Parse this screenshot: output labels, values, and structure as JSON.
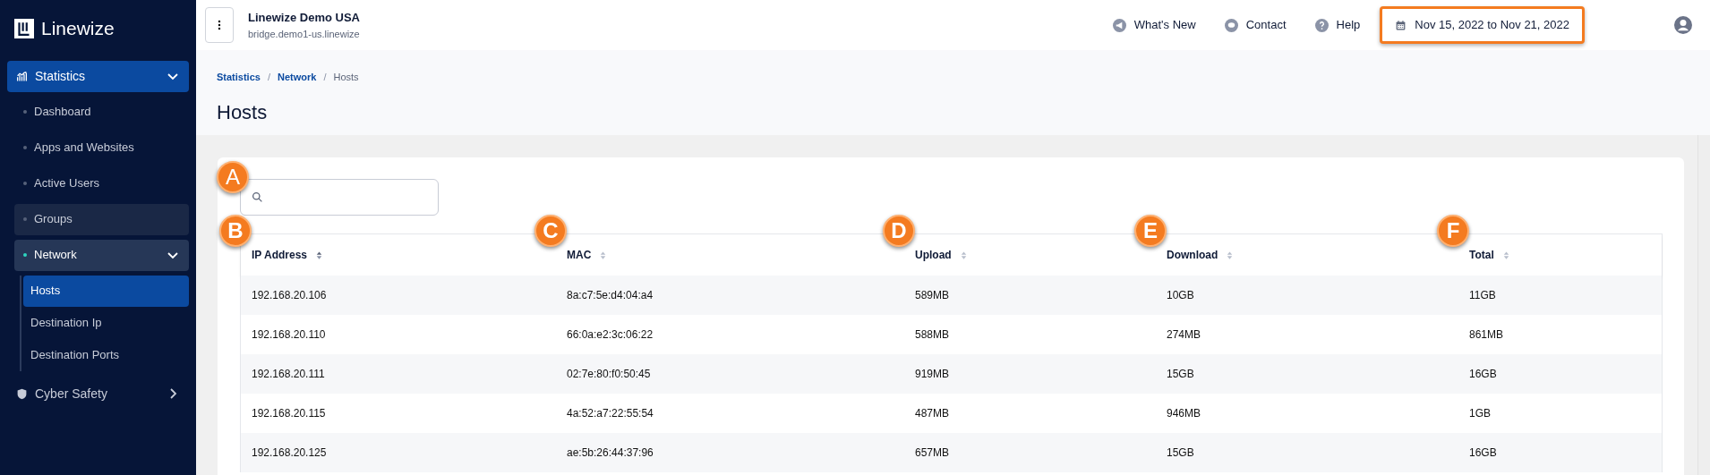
{
  "brand": {
    "name": "Linewize"
  },
  "sidebar": {
    "items": [
      {
        "label": "Statistics",
        "selected": true,
        "expanded": true,
        "children": [
          {
            "label": "Dashboard",
            "selected": false,
            "hovered": false
          },
          {
            "label": "Apps and Websites",
            "selected": false,
            "hovered": false
          },
          {
            "label": "Active Users",
            "selected": false,
            "hovered": false
          },
          {
            "label": "Groups",
            "selected": false,
            "hovered": true
          },
          {
            "label": "Network",
            "selected": true,
            "expanded": true,
            "children": [
              {
                "label": "Hosts",
                "selected": true
              },
              {
                "label": "Destination Ip",
                "selected": false
              },
              {
                "label": "Destination Ports",
                "selected": false
              }
            ]
          }
        ]
      },
      {
        "label": "Cyber Safety",
        "selected": false,
        "expanded": false
      }
    ]
  },
  "header": {
    "title": "Linewize Demo USA",
    "subtitle": "bridge.demo1-us.linewize",
    "links": [
      {
        "label": "What's New"
      },
      {
        "label": "Contact"
      },
      {
        "label": "Help"
      }
    ],
    "date_range": {
      "label": "Nov 15, 2022 to Nov 21, 2022",
      "highlighted": true
    }
  },
  "breadcrumb": [
    {
      "label": "Statistics",
      "current": false
    },
    {
      "separator": "/",
      "label": "Network",
      "current": false
    },
    {
      "separator": "/",
      "label": "Hosts",
      "current": true
    }
  ],
  "page_title": "Hosts",
  "search": {
    "marker": "A"
  },
  "table": {
    "columns": [
      {
        "label": "IP Address",
        "marker": "B",
        "sorted": true
      },
      {
        "label": "MAC",
        "marker": "C",
        "sorted": false
      },
      {
        "label": "Upload",
        "marker": "D",
        "sorted": false
      },
      {
        "label": "Download",
        "marker": "E",
        "sorted": false
      },
      {
        "label": "Total",
        "marker": "F",
        "sorted": false
      }
    ],
    "rows": [
      [
        "192.168.20.106",
        "8a:c7:5e:d4:04:a4",
        "589MB",
        "10GB",
        "11GB"
      ],
      [
        "192.168.20.110",
        "66:0a:e2:3c:06:22",
        "588MB",
        "274MB",
        "861MB"
      ],
      [
        "192.168.20.111",
        "02:7e:80:f0:50:45",
        "919MB",
        "15GB",
        "16GB"
      ],
      [
        "192.168.20.115",
        "4a:52:a7:22:55:54",
        "487MB",
        "946MB",
        "1GB"
      ],
      [
        "192.168.20.125",
        "ae:5b:26:44:37:96",
        "657MB",
        "15GB",
        "16GB"
      ]
    ]
  }
}
